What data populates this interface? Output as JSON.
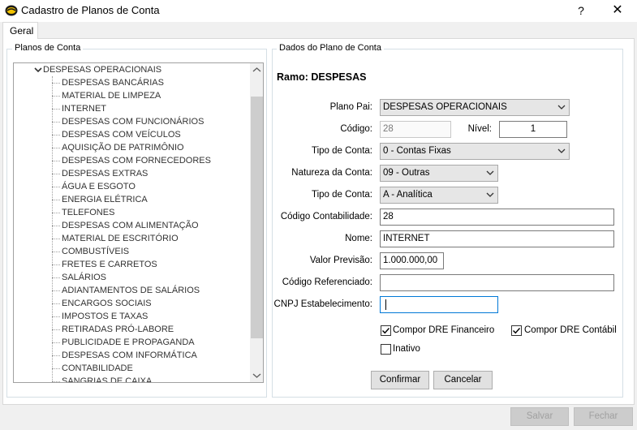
{
  "window": {
    "title": "Cadastro de Planos de Conta",
    "help": "?",
    "close": "✕"
  },
  "tabs": [
    {
      "label": "Geral"
    }
  ],
  "planos": {
    "group_label": "Planos de Conta",
    "parent": "DESPESAS OPERACIONAIS",
    "children": [
      "DESPESAS BANCÁRIAS",
      "MATERIAL DE LIMPEZA",
      "INTERNET",
      "DESPESAS COM FUNCIONÁRIOS",
      "DESPESAS COM VEÍCULOS",
      "AQUISIÇÃO DE PATRIMÔNIO",
      "DESPESAS COM FORNECEDORES",
      "DESPESAS EXTRAS",
      "ÁGUA E ESGOTO",
      "ENERGIA ELÉTRICA",
      "TELEFONES",
      "DESPESAS COM ALIMENTAÇÃO",
      "MATERIAL DE ESCRITÓRIO",
      "COMBUSTÍVEIS",
      "FRETES E CARRETOS",
      "SALÁRIOS",
      "ADIANTAMENTOS DE SALÁRIOS",
      "ENCARGOS SOCIAIS",
      "IMPOSTOS E TAXAS",
      "RETIRADAS PRÓ-LABORE",
      "PUBLICIDADE E PROPAGANDA",
      "DESPESAS COM INFORMÁTICA",
      "CONTABILIDADE",
      "SANGRIAS DE CAIXA"
    ]
  },
  "dados": {
    "group_label": "Dados do Plano de Conta",
    "ramo_label": "Ramo:",
    "ramo_value": "DESPESAS",
    "plano_pai": {
      "label": "Plano Pai:",
      "value": "DESPESAS OPERACIONAIS"
    },
    "codigo": {
      "label": "Código:",
      "value": "28"
    },
    "nivel": {
      "label": "Nível:",
      "value": "1"
    },
    "tipo_conta_1": {
      "label": "Tipo de Conta:",
      "value": "0 - Contas Fixas"
    },
    "natureza": {
      "label": "Natureza da Conta:",
      "value": "09 - Outras"
    },
    "tipo_conta_2": {
      "label": "Tipo de Conta:",
      "value": "A - Analítica"
    },
    "codigo_contabilidade": {
      "label": "Código Contabilidade:",
      "value": "28"
    },
    "nome": {
      "label": "Nome:",
      "value": "INTERNET"
    },
    "valor_previsao": {
      "label": "Valor Previsão:",
      "value": "1.000.000,00"
    },
    "codigo_referenciado": {
      "label": "Código Referenciado:",
      "value": ""
    },
    "cnpj": {
      "label": "CNPJ Estabelecimento:",
      "value": ""
    },
    "compor_dre_financeiro": {
      "label": "Compor DRE Financeiro",
      "checked": true
    },
    "compor_dre_contabil": {
      "label": "Compor DRE Contábil",
      "checked": true
    },
    "inativo": {
      "label": "Inativo",
      "checked": false
    },
    "confirmar": "Confirmar",
    "cancelar": "Cancelar"
  },
  "footer": {
    "salvar": "Salvar",
    "fechar": "Fechar"
  }
}
